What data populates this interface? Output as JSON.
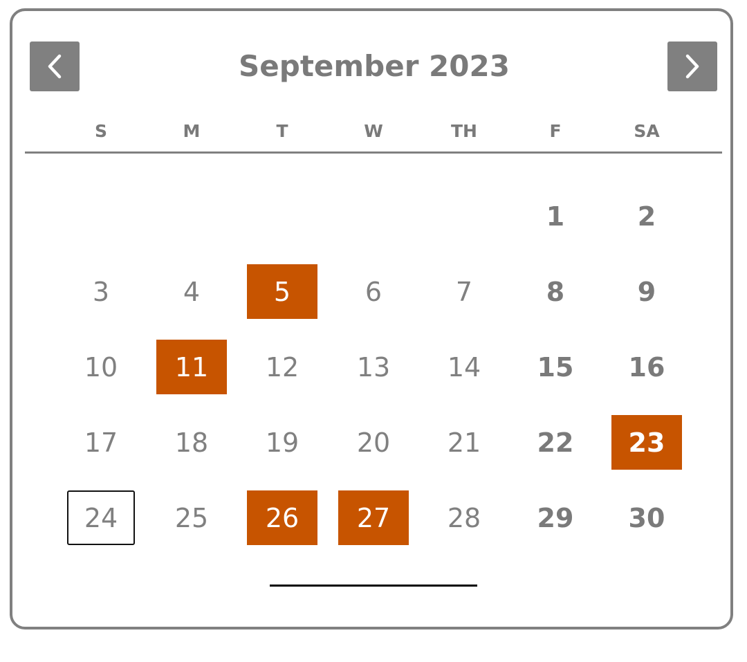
{
  "header": {
    "month_title": "September 2023",
    "prev_icon": "chevron-left-icon",
    "next_icon": "chevron-right-icon"
  },
  "weekdays": [
    "S",
    "M",
    "T",
    "W",
    "TH",
    "F",
    "SA"
  ],
  "days": [
    {
      "label": "1"
    },
    {
      "label": "2"
    },
    {
      "label": "3"
    },
    {
      "label": "4"
    },
    {
      "label": "5"
    },
    {
      "label": "6"
    },
    {
      "label": "7"
    },
    {
      "label": "8"
    },
    {
      "label": "9"
    },
    {
      "label": "10"
    },
    {
      "label": "11"
    },
    {
      "label": "12"
    },
    {
      "label": "13"
    },
    {
      "label": "14"
    },
    {
      "label": "15"
    },
    {
      "label": "16"
    },
    {
      "label": "17"
    },
    {
      "label": "18"
    },
    {
      "label": "19"
    },
    {
      "label": "20"
    },
    {
      "label": "21"
    },
    {
      "label": "22"
    },
    {
      "label": "23"
    },
    {
      "label": "24"
    },
    {
      "label": "25"
    },
    {
      "label": "26"
    },
    {
      "label": "27"
    },
    {
      "label": "28"
    },
    {
      "label": "29"
    },
    {
      "label": "30"
    }
  ],
  "first_weekday_index": 5,
  "selected_days": [
    5,
    11,
    23,
    26,
    27
  ],
  "outlined_day": 24,
  "colors": {
    "accent": "#c75400",
    "frame": "#808080",
    "text": "#808080",
    "selected_text": "#ffffff"
  }
}
